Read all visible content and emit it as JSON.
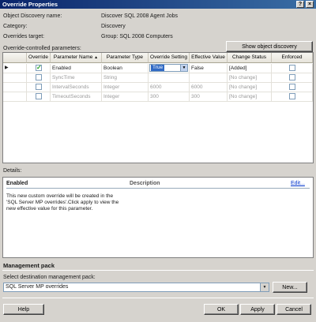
{
  "window": {
    "title": "Override Properties",
    "help_glyph": "?",
    "close_glyph": "×"
  },
  "info": {
    "discovery_label": "Object Discovery name:",
    "discovery_value": "Discover SQL 2008 Agent Jobs",
    "category_label": "Category:",
    "category_value": "Discovery",
    "target_label": "Overrides target:",
    "target_value": "Group: SQL 2008 Computers"
  },
  "show_properties_button": "Show object discovery properties...",
  "params_label": "Override-controlled parameters:",
  "grid": {
    "columns": [
      "Override",
      "Parameter Name",
      "Parameter Type",
      "Override Setting",
      "Effective Value",
      "Change Status",
      "Enforced"
    ],
    "sort_glyph": "▲",
    "row_marker": "▶",
    "dropdown_glyph": "▼",
    "rows": [
      {
        "override": true,
        "name": "Enabled",
        "type": "Boolean",
        "setting": "True",
        "effective": "False",
        "status": "[Added]",
        "enforced": false
      },
      {
        "override": false,
        "name": "SyncTime",
        "type": "String",
        "setting": "",
        "effective": "",
        "status": "[No change]",
        "enforced": false
      },
      {
        "override": false,
        "name": "IntervalSeconds",
        "type": "Integer",
        "setting": "6000",
        "effective": "6000",
        "status": "[No change]",
        "enforced": false
      },
      {
        "override": false,
        "name": "TimeoutSeconds",
        "type": "Integer",
        "setting": "300",
        "effective": "300",
        "status": "[No change]",
        "enforced": false
      }
    ]
  },
  "details": {
    "label": "Details:",
    "param_name": "Enabled",
    "description_header": "Description",
    "edit_link": "Edit...",
    "text": "This new custom override will be created in the 'SQL Server MP overrides'.Click apply to view  the new effective value for this parameter."
  },
  "management_pack": {
    "heading": "Management pack",
    "select_label": "Select destination management pack:",
    "selected": "SQL Server MP overrides",
    "new_button": "New..."
  },
  "buttons": {
    "help": "Help",
    "ok": "OK",
    "apply": "Apply",
    "cancel": "Cancel"
  }
}
